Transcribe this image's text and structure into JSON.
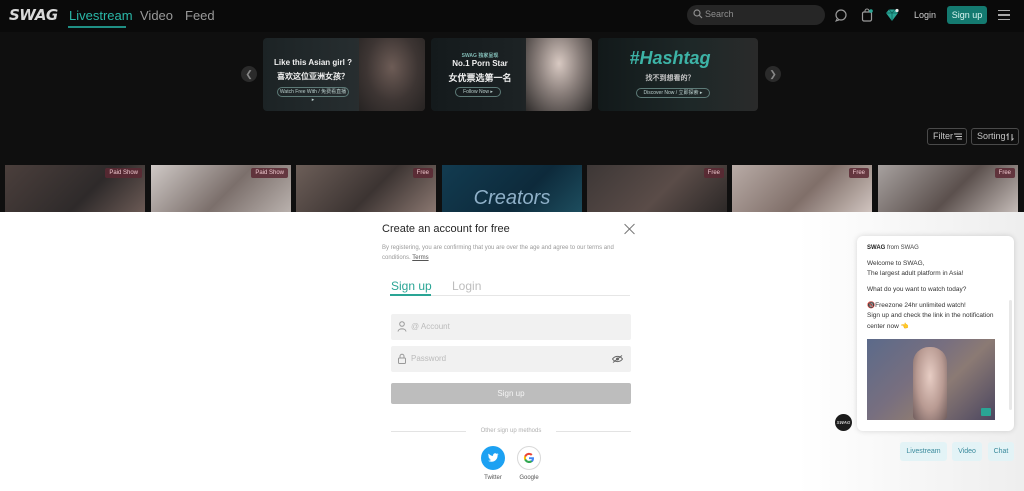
{
  "header": {
    "logo": "SWAG",
    "nav": [
      "Livestream",
      "Video",
      "Feed"
    ],
    "search_placeholder": "Search",
    "login": "Login",
    "signup": "Sign up"
  },
  "banners": [
    {
      "title": "Like this Asian girl ?",
      "subtitle": "喜欢这位亚洲女孩？",
      "button": "Watch Free With / 免费看直播 ▸"
    },
    {
      "kicker": "SWAG 独家呈现",
      "title": "No.1 Porn Star",
      "subtitle": "女优票选第一名",
      "button": "Follow Now ▸"
    },
    {
      "title": "#Hashtag",
      "subtitle": "找不到想看的？",
      "button": "Discover Now / 立即探索 ▸"
    }
  ],
  "controls": {
    "filter": "Filter",
    "sorting": "Sorting"
  },
  "cards": [
    {
      "tag": "Paid Show"
    },
    {
      "tag": "Paid Show"
    },
    {
      "tag": "Free"
    },
    {
      "label": "Creators"
    },
    {
      "tag": "Free"
    },
    {
      "tag": "Free"
    },
    {
      "tag": "Free"
    }
  ],
  "modal": {
    "title": "Create an account for free",
    "disclaimer": "By registering, you are confirming that you are over the age and agree to our terms and conditions.",
    "terms": "Terms",
    "tab_signup": "Sign up",
    "tab_login": "Login",
    "account_placeholder": "@ Account",
    "password_placeholder": "Password",
    "submit": "Sign up",
    "other_methods": "Other sign up methods",
    "twitter": "Twitter",
    "google": "Google"
  },
  "chat": {
    "from_name": "SWAG",
    "from_suffix": " from SWAG",
    "line1": "Welcome to SWAG,",
    "line2": "The largest adult platform in Asia!",
    "line3": "What do you want to watch today?",
    "line4": "🔞Freezone 24hr unlimited watch!",
    "line5": "Sign up and check the link in the notification center now 👈",
    "avatar": "SWAG",
    "quick_replies": [
      "Livestream",
      "Video",
      "Chat"
    ]
  },
  "colors": {
    "accent": "#2aa595",
    "brand_dark": "#147a70",
    "bg": "#0f0f0f"
  }
}
